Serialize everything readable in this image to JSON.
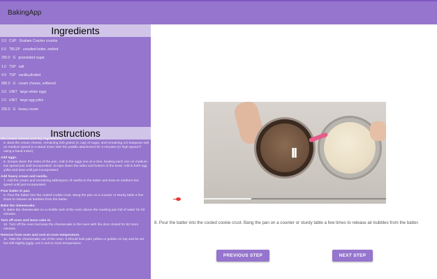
{
  "app": {
    "title": "BakingApp"
  },
  "ingredients": {
    "header": "Ingredients",
    "items": [
      {
        "qty": "2.0",
        "unit": "CUP",
        "name": "Graham Cracker crumbs"
      },
      {
        "qty": "6.0",
        "unit": "TBLSP",
        "name": "unsalted butter, melted"
      },
      {
        "qty": "250.0",
        "unit": "G",
        "name": "granulated sugar"
      },
      {
        "qty": "1.0",
        "unit": "TSP",
        "name": "salt"
      },
      {
        "qty": "4.0",
        "unit": "TSP",
        "name": "vanilla,divided"
      },
      {
        "qty": "680.0",
        "unit": "G",
        "name": "cream cheese, softened"
      },
      {
        "qty": "3.0",
        "unit": "UNIT",
        "name": "large whole eggs"
      },
      {
        "qty": "2.0",
        "unit": "UNIT",
        "name": "large egg yolks"
      },
      {
        "qty": "250.0",
        "unit": "G",
        "name": "heavy cream"
      }
    ]
  },
  "instructions": {
    "header": "Instructions",
    "steps": [
      {
        "title": "Mix cream cheese and dry ingredients.",
        "body": "5. Beat the cream cheese, remaining 200 grams (1 cup) of sugar, and remaining 1/2 teaspoon salt on medium speed in a stand mixer with the paddle attachment for 3 minutes (or high speed if using a hand mixer)."
      },
      {
        "title": "Add eggs.",
        "body": "6. Scrape down the sides of the pan. Add in the eggs one at a time, beating each one on medium-low speed just until incorporated. Scrape down the sides and bottom of the bowl. Add in both egg yolks and beat until just incorporated."
      },
      {
        "title": "Add heavy cream and vanilla.",
        "body": "7. Add the cream and remaining tablespoon of vanilla to the batter and beat on medium-low speed until just incorporated."
      },
      {
        "title": "Pour batter in pan.",
        "body": "8. Pour the batter into the cooled cookie crust. Bang the pan on a counter or sturdy table a few times to release air bubbles from the batter."
      },
      {
        "title": "Bake the cheesecake.",
        "body": "9. Bake the cheesecake on a middle rack of the oven above the roasting pan full of water for 50 minutes."
      },
      {
        "title": "Turn off oven and leave cake in.",
        "body": "10. Turn off the oven but keep the cheesecake in the oven with the door closed for 50 more minutes."
      },
      {
        "title": "Remove from oven and cool at room temperature.",
        "body": "11. Take the cheesecake out of the oven. It should look pale yellow or golden on top and be set but still slightly jiggly. Let it cool to room temperature."
      }
    ]
  },
  "video": {
    "progress": 0.26,
    "pause_glyph": "II",
    "accent": "#e53935"
  },
  "step": {
    "description": "8. Pour the batter into the cooled cookie crust. Bang the pan on a counter or sturdy table a few times to release air bubbles from the batter."
  },
  "buttons": {
    "previous": "PREVIOUS STEP",
    "next": "NEXT STEP"
  },
  "colors": {
    "primary": "#9575cd",
    "header_bg": "#d1c4e9"
  }
}
